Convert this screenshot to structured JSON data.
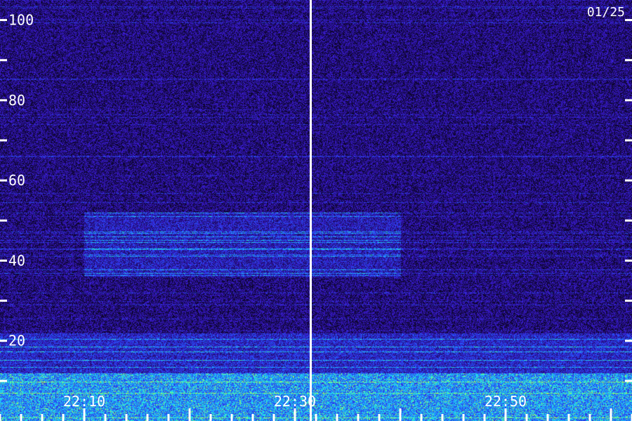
{
  "chart_data": {
    "type": "heatmap",
    "title": "",
    "date_label": "01/25",
    "xlabel": "",
    "ylabel": "",
    "x_unit": "time (HH:MM)",
    "x_tick_labels": [
      "22:10",
      "22:30",
      "22:50"
    ],
    "x_tick_values_min": [
      1330,
      1350,
      1370
    ],
    "x_range_min": [
      1322,
      1382
    ],
    "y_tick_labels": [
      "20",
      "40",
      "60",
      "80",
      "100"
    ],
    "y_tick_values": [
      20,
      40,
      60,
      80,
      100
    ],
    "y_minor_tick_values": [
      10,
      30,
      50,
      70,
      90
    ],
    "y_range": [
      0,
      105
    ],
    "divider_time_min": 1351.5,
    "features": [
      {
        "name": "strong low-frequency band",
        "y_from": 0,
        "y_to": 12,
        "intensity": 1.0
      },
      {
        "name": "weak band",
        "y_from": 12,
        "y_to": 22,
        "intensity": 0.45
      },
      {
        "name": "mid-frequency enhancement",
        "x_from_min": 1330,
        "x_to_min": 1360,
        "y_from": 36,
        "y_to": 52,
        "intensity": 0.35
      }
    ],
    "colormap": [
      "#000000",
      "#1a0a5a",
      "#3a1ad0",
      "#2060ff",
      "#20c8ff",
      "#30ffb0",
      "#c8ff40"
    ],
    "legend": "none",
    "grid": false
  }
}
